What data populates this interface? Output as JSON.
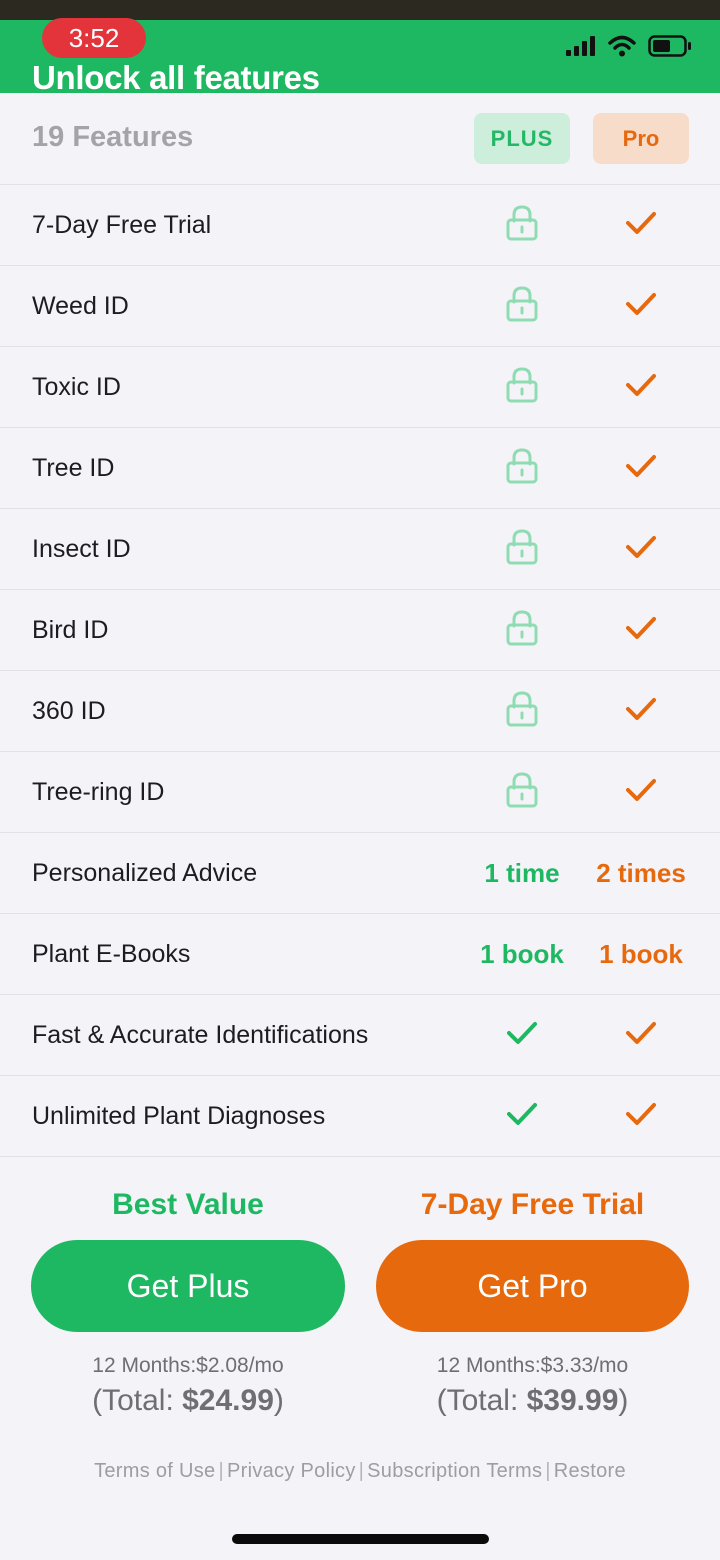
{
  "status_bar": {
    "time": "3:52"
  },
  "header": {
    "title": "Unlock all features"
  },
  "table": {
    "feature_count": "19 Features",
    "columns": {
      "plus": "PLUS",
      "pro": "Pro"
    },
    "rows": [
      {
        "label": "7-Day Free Trial",
        "plus_icon": "lock-icon",
        "pro_icon": "check-icon"
      },
      {
        "label": "Weed ID",
        "plus_icon": "lock-icon",
        "pro_icon": "check-icon"
      },
      {
        "label": "Toxic ID",
        "plus_icon": "lock-icon",
        "pro_icon": "check-icon"
      },
      {
        "label": "Tree ID",
        "plus_icon": "lock-icon",
        "pro_icon": "check-icon"
      },
      {
        "label": "Insect ID",
        "plus_icon": "lock-icon",
        "pro_icon": "check-icon"
      },
      {
        "label": "Bird ID",
        "plus_icon": "lock-icon",
        "pro_icon": "check-icon"
      },
      {
        "label": "360 ID",
        "plus_icon": "lock-icon",
        "pro_icon": "check-icon"
      },
      {
        "label": "Tree-ring ID",
        "plus_icon": "lock-icon",
        "pro_icon": "check-icon"
      },
      {
        "label": "Personalized Advice",
        "plus_text": "1 time",
        "pro_text": "2 times"
      },
      {
        "label": "Plant E-Books",
        "plus_text": "1 book",
        "pro_text": "1 book"
      },
      {
        "label": "Fast & Accurate Identifications",
        "plus_icon": "check-icon",
        "pro_icon": "check-icon"
      },
      {
        "label": "Unlimited Plant Diagnoses",
        "plus_icon": "check-icon",
        "pro_icon": "check-icon"
      }
    ]
  },
  "plans": {
    "plus": {
      "tag": "Best Value",
      "button": "Get Plus",
      "price_line": "12 Months:$2.08/mo",
      "total_prefix": "(Total: ",
      "total": "$24.99",
      "total_suffix": ")"
    },
    "pro": {
      "tag": "7-Day Free Trial",
      "button": "Get Pro",
      "price_line": "12 Months:$3.33/mo",
      "total_prefix": "(Total: ",
      "total": "$39.99",
      "total_suffix": ")"
    }
  },
  "footer": {
    "terms": "Terms of Use",
    "privacy": "Privacy Policy",
    "subscription": "Subscription Terms",
    "restore": "Restore",
    "separator": "|"
  },
  "colors": {
    "green": "#1db861",
    "orange": "#e7690e",
    "lock_green": "#8fdcb3"
  }
}
